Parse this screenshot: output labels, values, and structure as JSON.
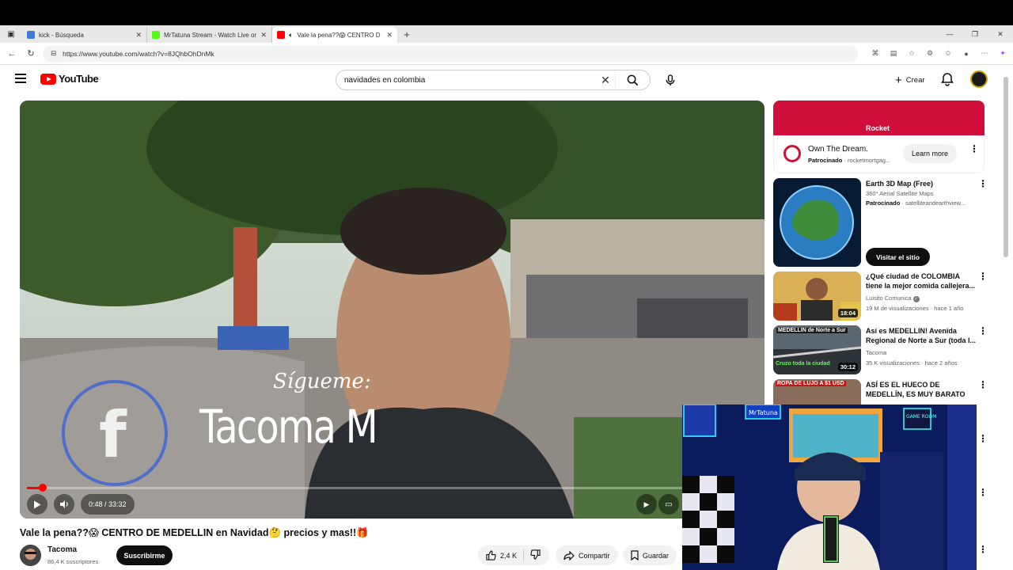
{
  "browser": {
    "tabs": [
      {
        "label": "kick - Búsqueda",
        "favicon_color": "#3c7bd6"
      },
      {
        "label": "MrTatuna Stream - Watch Live on",
        "favicon_color": "#53fc18"
      },
      {
        "label": "Vale la pena??😱 CENTRO D",
        "favicon_color": "#ff0000",
        "active": true
      }
    ],
    "url": "https://www.youtube.com/watch?v=8JQhbOhDnMk"
  },
  "header": {
    "logo_text": "YouTube",
    "search_value": "navidades en colombia",
    "create_label": "Crear"
  },
  "player": {
    "overlay_subtitle": "Sígueme:",
    "overlay_name": "Tacoma M",
    "time": "0:48 / 33:32",
    "progress": 0.024
  },
  "video": {
    "title": "Vale la pena??😱 CENTRO DE MEDELLIN en Navidad🤔 precios y mas!!🎁",
    "channel": "Tacoma",
    "subscribers": "86,4 K suscriptores",
    "subscribe_label": "Suscribirme",
    "likes": "2,4 K",
    "share_label": "Compartir",
    "save_label": "Guardar"
  },
  "sidebar": {
    "ad": {
      "brand": "Rocket",
      "title": "Own The Dream.",
      "sponsored": "Patrocinado",
      "domain": "rocketmortgag...",
      "cta": "Learn more"
    },
    "ad2": {
      "title": "Earth 3D Map (Free)",
      "subtitle": "360° Aerial Satellite Maps",
      "sponsored": "Patrocinado",
      "domain": "satelliteandearthview...",
      "cta": "Visitar el sitio"
    },
    "videos": [
      {
        "title": "¿Qué ciudad de COLOMBIA tiene la mejor comida callejera...",
        "channel": "Luisito Comunica",
        "meta": "19 M de visualizaciones · hace 1 año",
        "duration": "18:04"
      },
      {
        "title": "Así es MEDELLIN! Avenida Regional de Norte a Sur (toda l...",
        "channel": "Tacoma",
        "meta": "35 K visualizaciones · hace 2 años",
        "duration": "30:12",
        "thumb_text": "MEDELLIN de Norte a Sur",
        "thumb_text2": "Cruzo toda la ciudad"
      },
      {
        "title": "ASÍ ES EL HUECO DE MEDELLÍN, ES MUY BARATO",
        "thumb_text": "ROPA DE LUJO A $1 USD"
      }
    ]
  },
  "webcam": {
    "sign1": "MrTatuna",
    "sign2": "GAME ROOM"
  },
  "colors": {
    "yt_red": "#ff0000",
    "rocket_red": "#d0103a"
  }
}
